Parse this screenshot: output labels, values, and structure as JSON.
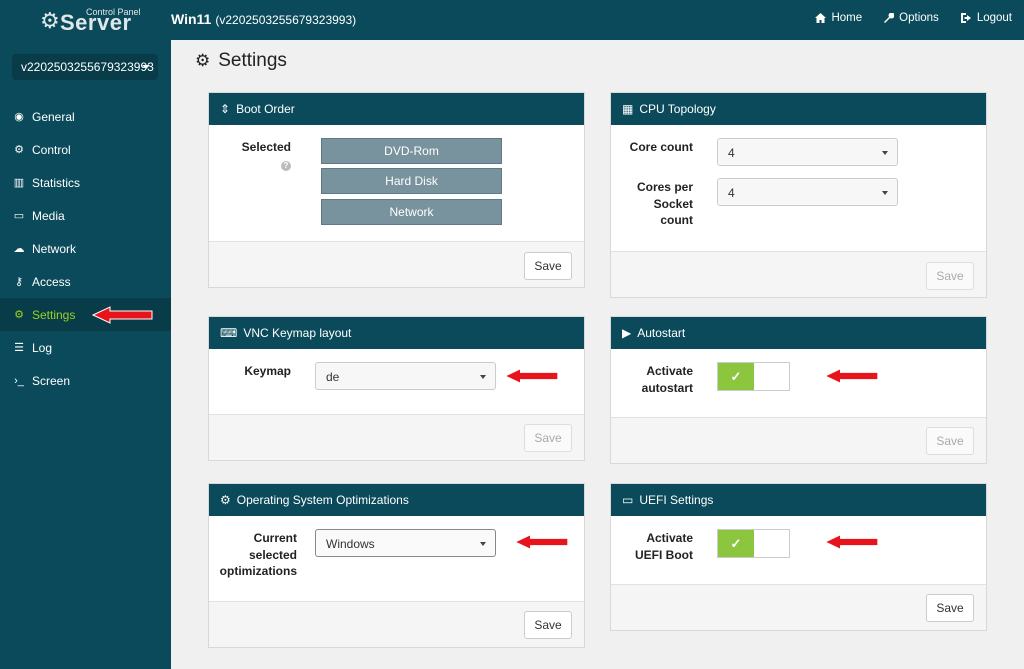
{
  "brand": {
    "control_panel": "Control Panel",
    "server": "Server"
  },
  "header": {
    "vm_name": "Win11",
    "vm_id": "(v2202503255679323993)",
    "nav": [
      {
        "label": "Home",
        "icon": "home-icon"
      },
      {
        "label": "Options",
        "icon": "wrench-icon"
      },
      {
        "label": "Logout",
        "icon": "logout-icon"
      }
    ]
  },
  "sidebar": {
    "server_select": "v2202503255679323993",
    "items": [
      {
        "label": "General",
        "icon": "eye-icon"
      },
      {
        "label": "Control",
        "icon": "gear-icon"
      },
      {
        "label": "Statistics",
        "icon": "bar-chart-icon"
      },
      {
        "label": "Media",
        "icon": "hdd-icon"
      },
      {
        "label": "Network",
        "icon": "cloud-icon"
      },
      {
        "label": "Access",
        "icon": "key-icon"
      },
      {
        "label": "Settings",
        "icon": "cogs-icon",
        "active": true
      },
      {
        "label": "Log",
        "icon": "list-icon"
      },
      {
        "label": "Screen",
        "icon": "terminal-icon"
      }
    ]
  },
  "page": {
    "title": "Settings"
  },
  "panels": {
    "boot_order": {
      "title": "Boot Order",
      "selected_label": "Selected",
      "items": [
        "DVD-Rom",
        "Hard Disk",
        "Network"
      ],
      "save": "Save"
    },
    "cpu_topology": {
      "title": "CPU Topology",
      "core_count_label": "Core count",
      "core_count_value": "4",
      "cores_per_socket_label": "Cores per Socket count",
      "cores_per_socket_value": "4",
      "save": "Save"
    },
    "vnc_keymap": {
      "title": "VNC Keymap layout",
      "keymap_label": "Keymap",
      "keymap_value": "de",
      "save": "Save"
    },
    "autostart": {
      "title": "Autostart",
      "label": "Activate autostart",
      "enabled": true,
      "save": "Save"
    },
    "os_optimizations": {
      "title": "Operating System Optimizations",
      "label": "Current selected optimizations",
      "value": "Windows",
      "save": "Save"
    },
    "uefi": {
      "title": "UEFI Settings",
      "label": "Activate UEFI Boot",
      "enabled": true,
      "save": "Save"
    }
  },
  "colors": {
    "header_bg": "#0b4a5a",
    "active": "#9bd223",
    "toggle_on": "#8cc63f",
    "arrow": "#e8141b"
  }
}
